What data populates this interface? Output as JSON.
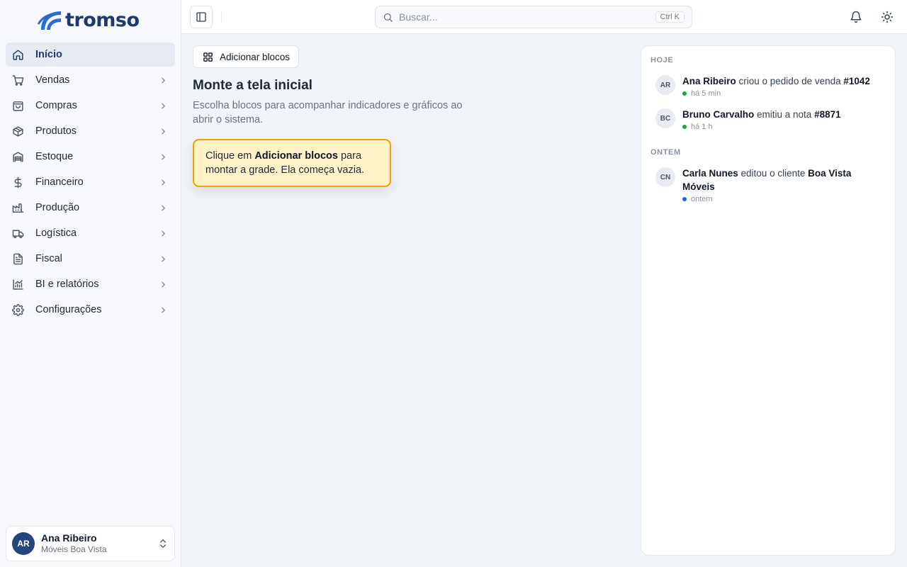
{
  "brand": {
    "name": "tromso",
    "color": "#1e3a6e",
    "accent": "#2d6bd6"
  },
  "sidebar": {
    "items": [
      {
        "label": "Início",
        "icon": "home-icon",
        "active": true,
        "has_children": false
      },
      {
        "label": "Vendas",
        "icon": "cart-icon",
        "active": false,
        "has_children": true
      },
      {
        "label": "Compras",
        "icon": "shopping-bag-icon",
        "active": false,
        "has_children": true
      },
      {
        "label": "Produtos",
        "icon": "box-icon",
        "active": false,
        "has_children": true
      },
      {
        "label": "Estoque",
        "icon": "warehouse-icon",
        "active": false,
        "has_children": true
      },
      {
        "label": "Financeiro",
        "icon": "dollar-icon",
        "active": false,
        "has_children": true
      },
      {
        "label": "Produção",
        "icon": "factory-icon",
        "active": false,
        "has_children": true
      },
      {
        "label": "Logística",
        "icon": "truck-icon",
        "active": false,
        "has_children": true
      },
      {
        "label": "Fiscal",
        "icon": "document-icon",
        "active": false,
        "has_children": true
      },
      {
        "label": "BI e relatórios",
        "icon": "chart-icon",
        "active": false,
        "has_children": true
      },
      {
        "label": "Configurações",
        "icon": "gear-icon",
        "active": false,
        "has_children": true
      }
    ]
  },
  "user": {
    "initials": "AR",
    "name": "Ana Ribeiro",
    "company": "Móveis Boa Vista",
    "avatar_color": "#24467f"
  },
  "topbar": {
    "search_placeholder": "Buscar...",
    "search_shortcut": "Ctrl K",
    "icons": [
      "sidebar-toggle-icon",
      "search-icon",
      "bell-icon",
      "sun-icon"
    ]
  },
  "main": {
    "add_blocks_label": "Adicionar blocos",
    "title": "Monte a tela inicial",
    "subtitle": "Escolha blocos para acompanhar indicadores e gráficos ao abrir o sistema.",
    "tip": {
      "prefix": "Clique em ",
      "bold": "Adicionar blocos",
      "suffix": " para montar a grade. Ela começa vazia.",
      "bg": "#fef3c7",
      "border": "#f59e0b"
    }
  },
  "activity": {
    "groups": [
      {
        "label": "HOJE",
        "items": [
          {
            "initials": "AR",
            "actor": "Ana Ribeiro",
            "action": " criou o pedido de venda ",
            "target": "#1042",
            "time": "há 5 min",
            "dot_color": "#16a34a"
          },
          {
            "initials": "BC",
            "actor": "Bruno Carvalho",
            "action": " emitiu a nota ",
            "target": "#8871",
            "time": "há 1 h",
            "dot_color": "#16a34a"
          }
        ]
      },
      {
        "label": "ONTEM",
        "items": [
          {
            "initials": "CN",
            "actor": "Carla Nunes",
            "action": " editou o cliente ",
            "target": "Boa Vista Móveis",
            "time": "ontem",
            "dot_color": "#2563eb"
          }
        ]
      }
    ]
  }
}
